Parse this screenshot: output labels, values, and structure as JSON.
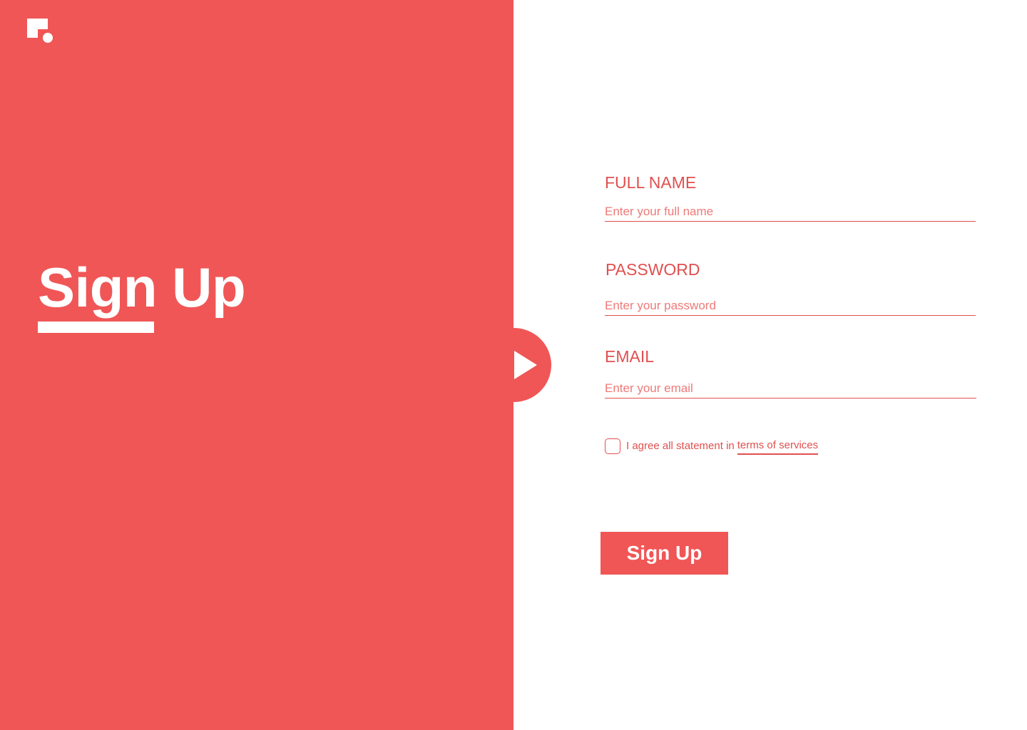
{
  "colors": {
    "accent": "#f05656",
    "text_accent": "#e0504f",
    "background": "#ffffff"
  },
  "logo": {
    "icon": "brand-logo-icon"
  },
  "hero": {
    "title": "Sign Up"
  },
  "toggle": {
    "icon": "play-arrow-icon"
  },
  "form": {
    "full_name": {
      "label": "FULL NAME",
      "placeholder": "Enter your full name",
      "value": ""
    },
    "password": {
      "label": "PASSWORD",
      "placeholder": "Enter your password",
      "value": ""
    },
    "email": {
      "label": "EMAIL",
      "placeholder": "Enter your email",
      "value": ""
    },
    "agree": {
      "checked": false,
      "text": "I agree all statement in",
      "link_text": "terms of services"
    },
    "submit_label": "Sign Up"
  }
}
